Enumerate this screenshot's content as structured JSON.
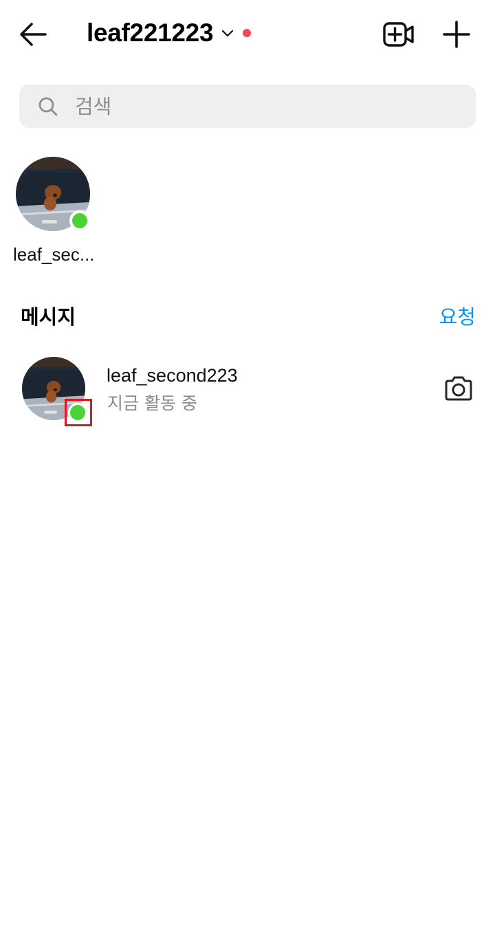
{
  "header": {
    "title": "leaf221223",
    "back_icon": "arrow-left-icon",
    "chevron_icon": "chevron-down-icon",
    "notification_dot_color": "#ed4956",
    "new_video_icon": "video-call-plus-icon",
    "new_message_icon": "plus-icon"
  },
  "search": {
    "placeholder": "검색",
    "icon": "search-icon"
  },
  "active_users": [
    {
      "name": "leaf_sec...",
      "online": true
    }
  ],
  "messages_section": {
    "title": "메시지",
    "requests_label": "요청"
  },
  "threads": [
    {
      "name": "leaf_second223",
      "status": "지금 활동 중",
      "online": true,
      "action_icon": "camera-icon"
    }
  ],
  "colors": {
    "online": "#4cd137",
    "accent": "#0095f6",
    "search_bg": "#efefef",
    "highlight": "#e0161b"
  }
}
